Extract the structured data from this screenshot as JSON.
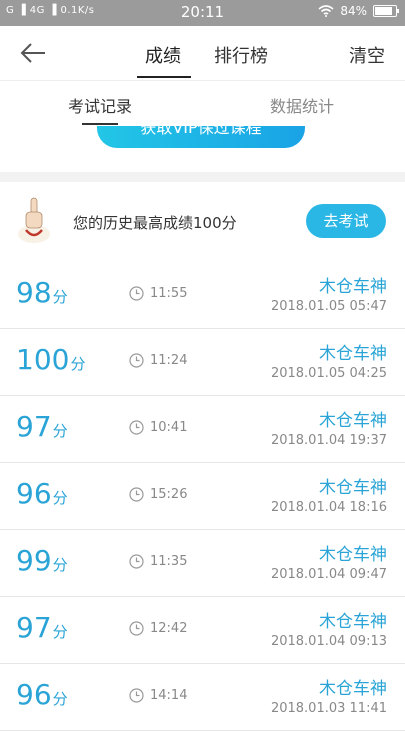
{
  "status_bar": {
    "left": "G ▐ 4G ▐ 0.1K/s",
    "time": "20:11",
    "battery": "84%",
    "battery_level": 0.84
  },
  "header": {
    "tabs": [
      {
        "label": "成绩"
      },
      {
        "label": "排行榜"
      }
    ],
    "clear_label": "清空"
  },
  "subtabs": [
    {
      "label": "考试记录"
    },
    {
      "label": "数据统计"
    }
  ],
  "banner": {
    "vip_label": "获取VIP保过课程"
  },
  "best": {
    "text": "您的历史最高成绩100分",
    "button": "去考试"
  },
  "records": [
    {
      "score": "98",
      "unit": "分",
      "time": "11:55",
      "name": "木仓车神",
      "datetime": "2018.01.05  05:47"
    },
    {
      "score": "100",
      "unit": "分",
      "time": "11:24",
      "name": "木仓车神",
      "datetime": "2018.01.05  04:25"
    },
    {
      "score": "97",
      "unit": "分",
      "time": "10:41",
      "name": "木仓车神",
      "datetime": "2018.01.04  19:37"
    },
    {
      "score": "96",
      "unit": "分",
      "time": "15:26",
      "name": "木仓车神",
      "datetime": "2018.01.04  18:16"
    },
    {
      "score": "99",
      "unit": "分",
      "time": "11:35",
      "name": "木仓车神",
      "datetime": "2018.01.04  09:47"
    },
    {
      "score": "97",
      "unit": "分",
      "time": "12:42",
      "name": "木仓车神",
      "datetime": "2018.01.04  09:13"
    },
    {
      "score": "96",
      "unit": "分",
      "time": "14:14",
      "name": "木仓车神",
      "datetime": "2018.01.03  11:41"
    }
  ]
}
